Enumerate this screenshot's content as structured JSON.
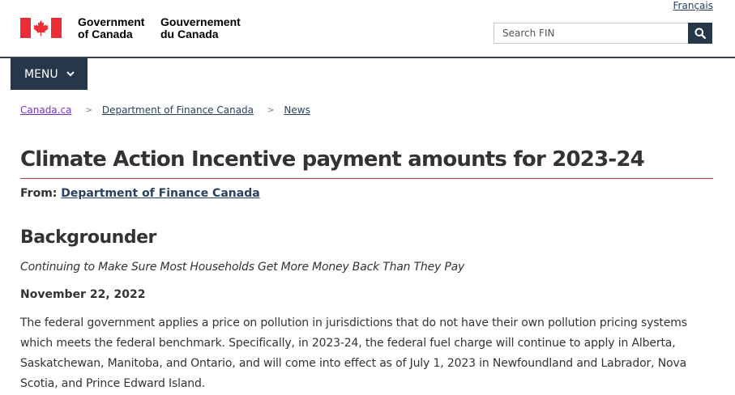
{
  "header": {
    "language_link": "Français",
    "signature_en": [
      "Government",
      "of Canada"
    ],
    "signature_fr": [
      "Gouvernement",
      "du Canada"
    ],
    "flag_icon": "canada-flag-icon",
    "search": {
      "placeholder": "Search FIN",
      "icon": "search-icon"
    },
    "colors": {
      "nav": "#26374a",
      "flag_red": "#eb2d37",
      "rule": "#af3c43"
    }
  },
  "menu": {
    "label": "MENU",
    "icon": "chevron-down-icon"
  },
  "breadcrumb": {
    "items": [
      "Canada.ca",
      "Department of Finance Canada",
      "News"
    ],
    "separator": ">"
  },
  "main": {
    "title": "Climate Action Incentive payment amounts for 2023-24",
    "from_label": "From:",
    "from_link": "Department of Finance Canada",
    "section_heading": "Backgrounder",
    "subtitle": "Continuing to Make Sure Most Households Get More Money Back Than They Pay",
    "date": "November 22, 2022",
    "paragraph": "The federal government applies a price on pollution in jurisdictions that do not have their own pollution pricing systems which meets the federal benchmark. Specifically, in 2023-24, the federal fuel charge will continue to apply in Alberta, Saskatchewan, Manitoba, and Ontario, and will come into effect as of July 1, 2023 in Newfoundland and Labrador, Nova Scotia, and Prince Edward Island."
  }
}
